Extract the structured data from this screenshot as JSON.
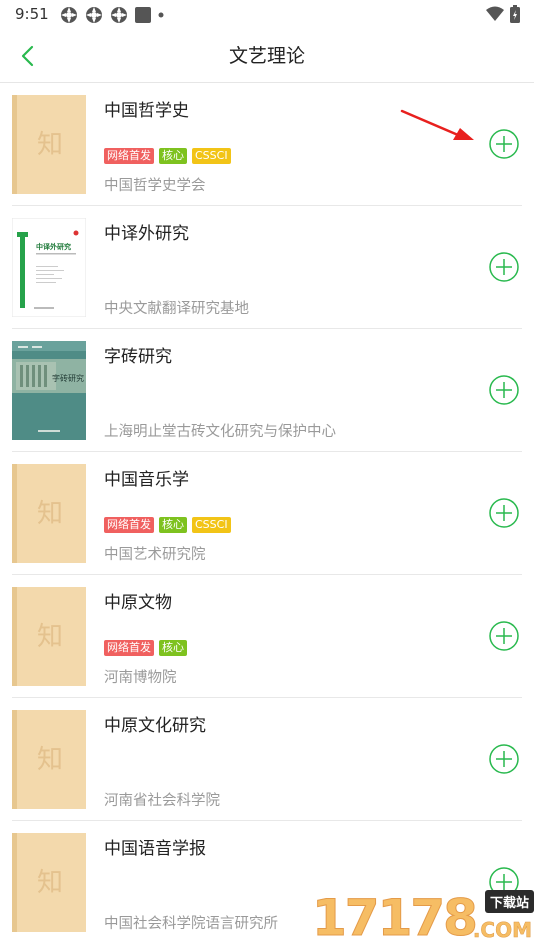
{
  "status": {
    "time": "9:51"
  },
  "header": {
    "title": "文艺理论"
  },
  "colors": {
    "accent": "#29b94e",
    "tag_red": "#f0605f",
    "tag_green": "#7ec21f",
    "tag_yellow": "#f2c417",
    "cover_beige": "#f3d9ac"
  },
  "journals": [
    {
      "title": "中国哲学史",
      "tags": [
        "网络首发",
        "核心",
        "CSSCI"
      ],
      "publisher": "中国哲学史学会",
      "cover": "placeholder",
      "cover_char": "知"
    },
    {
      "title": "中译外研究",
      "tags": [],
      "publisher": "中央文献翻译研究基地",
      "cover": "zhongyiwai",
      "cover_text": "中译外研究"
    },
    {
      "title": "字砖研究",
      "tags": [],
      "publisher": "上海明止堂古砖文化研究与保护中心",
      "cover": "zizhuan",
      "cover_text": "字砖研究"
    },
    {
      "title": "中国音乐学",
      "tags": [
        "网络首发",
        "核心",
        "CSSCI"
      ],
      "publisher": "中国艺术研究院",
      "cover": "placeholder",
      "cover_char": "知"
    },
    {
      "title": "中原文物",
      "tags": [
        "网络首发",
        "核心"
      ],
      "publisher": "河南博物院",
      "cover": "placeholder",
      "cover_char": "知"
    },
    {
      "title": "中原文化研究",
      "tags": [],
      "publisher": "河南省社会科学院",
      "cover": "placeholder",
      "cover_char": "知"
    },
    {
      "title": "中国语音学报",
      "tags": [],
      "publisher": "中国社会科学院语言研究所",
      "cover": "placeholder",
      "cover_char": "知"
    }
  ],
  "watermark": {
    "text": "17178",
    "badge": "下载站",
    "suffix": ".COM"
  }
}
